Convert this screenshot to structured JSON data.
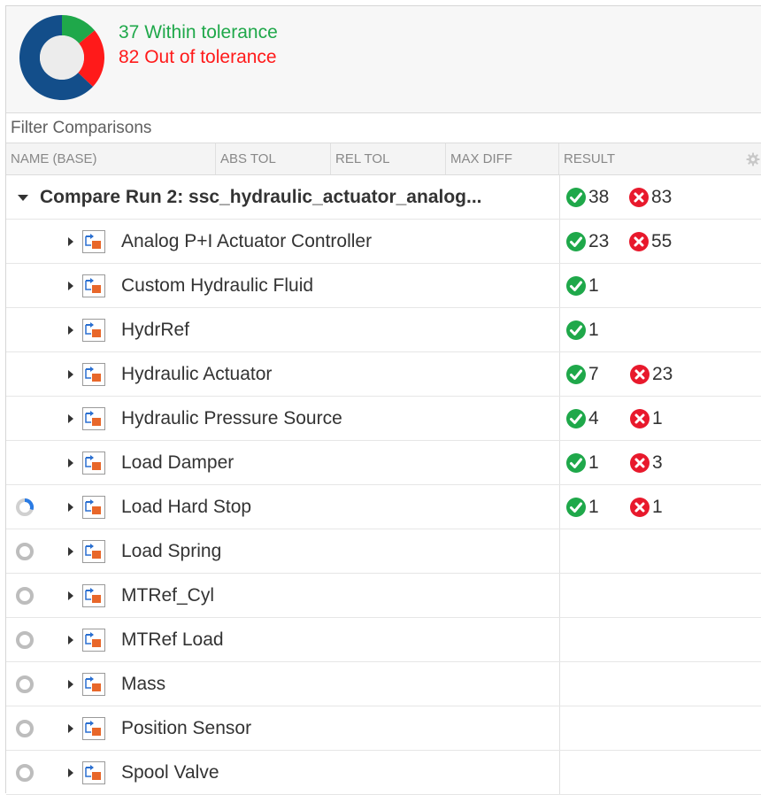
{
  "summary": {
    "within_text": "37 Within tolerance",
    "out_text": "82 Out of tolerance",
    "within_count": 37,
    "out_count": 82,
    "colors": {
      "within": "#1fa84a",
      "out": "#ff1a1a",
      "remaining": "#134e8a"
    }
  },
  "filter": {
    "placeholder": "Filter Comparisons"
  },
  "columns": {
    "name": "NAME (BASE)",
    "abs_tol": "ABS TOL",
    "rel_tol": "REL TOL",
    "max_diff": "MAX DIFF",
    "result": "RESULT",
    "settings_icon": "gear-icon"
  },
  "root": {
    "label": "Compare Run 2: ssc_hydraulic_actuator_analog...",
    "pass": "38",
    "fail": "83"
  },
  "items": [
    {
      "label": "Analog P+I Actuator Controller",
      "pass": "23",
      "fail": "55",
      "status": "done"
    },
    {
      "label": "Custom Hydraulic Fluid",
      "pass": "1",
      "fail": "",
      "status": "done"
    },
    {
      "label": "HydrRef",
      "pass": "1",
      "fail": "",
      "status": "done"
    },
    {
      "label": "Hydraulic Actuator",
      "pass": "7",
      "fail": "23",
      "status": "done"
    },
    {
      "label": "Hydraulic Pressure Source",
      "pass": "4",
      "fail": "1",
      "status": "done"
    },
    {
      "label": "Load Damper",
      "pass": "1",
      "fail": "3",
      "status": "done"
    },
    {
      "label": "Load Hard Stop",
      "pass": "1",
      "fail": "1",
      "status": "running"
    },
    {
      "label": "Load Spring",
      "pass": "",
      "fail": "",
      "status": "pending"
    },
    {
      "label": "MTRef_Cyl",
      "pass": "",
      "fail": "",
      "status": "pending"
    },
    {
      "label": "MTRef Load",
      "pass": "",
      "fail": "",
      "status": "pending"
    },
    {
      "label": "Mass",
      "pass": "",
      "fail": "",
      "status": "pending"
    },
    {
      "label": "Position Sensor",
      "pass": "",
      "fail": "",
      "status": "pending"
    },
    {
      "label": "Spool Valve",
      "pass": "",
      "fail": "",
      "status": "pending"
    }
  ],
  "colors": {
    "pass": "#1fa84a",
    "fail": "#e8192c",
    "spinner_active": "#2a7be4",
    "spinner_idle": "#bdbdbd"
  }
}
